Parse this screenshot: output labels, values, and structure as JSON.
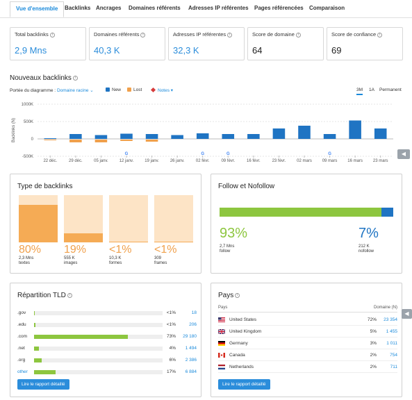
{
  "tabs": [
    "Vue d'ensemble",
    "Backlinks",
    "Ancrages",
    "Domaines référents",
    "Adresses IP référentes",
    "Pages référencées",
    "Comparaison"
  ],
  "kpis": [
    {
      "label": "Total backlinks",
      "value": "2,9 Mns"
    },
    {
      "label": "Domaines référents",
      "value": "40,3 K"
    },
    {
      "label": "Adresses IP référentes",
      "value": "32,3 K"
    },
    {
      "label": "Score de domaine",
      "value": "64"
    },
    {
      "label": "Score de confiance",
      "value": "69"
    }
  ],
  "backlinks_chart": {
    "title": "Nouveaux backlinks",
    "scope_label": "Portée du diagramme :",
    "scope_value": "Domaine racine",
    "legend": {
      "new": "New",
      "lost": "Lost",
      "notes": "Notes"
    },
    "periods": [
      "3M",
      "1A",
      "Permanent"
    ],
    "active_period": "3M",
    "ylabel": "Backlinks (N)",
    "y_ticks": [
      "1000K",
      "500K",
      "0",
      "-500K"
    ],
    "x_ticks": [
      "22 déc.",
      "29 déc.",
      "05 janv.",
      "12 janv.",
      "19 janv.",
      "26 janv.",
      "02 févr.",
      "09 févr.",
      "16 févr.",
      "23 févr.",
      "02 mars",
      "09 mars",
      "16 mars",
      "23 mars"
    ],
    "notes_marker": "G",
    "colors": {
      "new": "#1f74c3",
      "lost": "#f0a04b",
      "notes": "#d63c3c"
    }
  },
  "chart_data": {
    "type": "bar",
    "title": "Nouveaux backlinks",
    "xlabel": "",
    "ylabel": "Backlinks (N)",
    "ylim": [
      -500000,
      1000000
    ],
    "categories": [
      "22 déc.",
      "29 déc.",
      "05 janv.",
      "12 janv.",
      "19 janv.",
      "26 janv.",
      "02 févr.",
      "09 févr.",
      "16 févr.",
      "23 févr.",
      "02 mars",
      "09 mars",
      "16 mars",
      "23 mars"
    ],
    "series": [
      {
        "name": "New",
        "values": [
          20000,
          140000,
          110000,
          150000,
          140000,
          110000,
          160000,
          140000,
          140000,
          300000,
          380000,
          140000,
          530000,
          300000
        ]
      },
      {
        "name": "Lost",
        "values": [
          -10000,
          -80000,
          -80000,
          -40000,
          -60000,
          0,
          0,
          0,
          0,
          0,
          0,
          0,
          0,
          0
        ]
      }
    ],
    "notes_at": [
      "12 janv.",
      "02 févr.",
      "09 févr.",
      "09 mars"
    ]
  },
  "backlink_types": {
    "title": "Type de backlinks",
    "items": [
      {
        "pct": "80%",
        "count": "2,3 Mns",
        "label": "textes",
        "fill": 0.8
      },
      {
        "pct": "19%",
        "count": "555 K",
        "label": "images",
        "fill": 0.19
      },
      {
        "pct": "<1%",
        "count": "10,3 K",
        "label": "formes",
        "fill": 0.01
      },
      {
        "pct": "<1%",
        "count": "309",
        "label": "frames",
        "fill": 0.005
      }
    ]
  },
  "follow": {
    "title": "Follow et Nofollow",
    "follow_fraction": 0.93,
    "follow": {
      "pct": "93%",
      "count": "2,7 Mns",
      "label": "follow"
    },
    "nofollow": {
      "pct": "7%",
      "count": "212 K",
      "label": "nofollow"
    }
  },
  "tld": {
    "title": "Répartition TLD",
    "rows": [
      {
        "name": ".gov",
        "pct": "<1%",
        "count": "18",
        "fill": 0.003
      },
      {
        "name": ".edu",
        "pct": "<1%",
        "count": "206",
        "fill": 0.01
      },
      {
        "name": ".com",
        "pct": "73%",
        "count": "29 180",
        "fill": 0.73
      },
      {
        "name": ".net",
        "pct": "4%",
        "count": "1 494",
        "fill": 0.04
      },
      {
        "name": ".org",
        "pct": "6%",
        "count": "2 386",
        "fill": 0.06
      },
      {
        "name": "other",
        "pct": "17%",
        "count": "6 884",
        "fill": 0.17
      }
    ],
    "button": "Lire le rapport détaillé"
  },
  "countries": {
    "title": "Pays",
    "col_country": "Pays",
    "col_domains": "Domaine (N)",
    "rows": [
      {
        "name": "United States",
        "pct": "72%",
        "count": "23 354",
        "flag": "us-flag-icon"
      },
      {
        "name": "United Kingdom",
        "pct": "5%",
        "count": "1 455",
        "flag": "uk-flag-icon"
      },
      {
        "name": "Germany",
        "pct": "3%",
        "count": "1 011",
        "flag": "de-flag-icon"
      },
      {
        "name": "Canada",
        "pct": "2%",
        "count": "754",
        "flag": "ca-flag-icon"
      },
      {
        "name": "Netherlands",
        "pct": "2%",
        "count": "711",
        "flag": "nl-flag-icon"
      }
    ],
    "button": "Lire le rapport détaillé"
  }
}
